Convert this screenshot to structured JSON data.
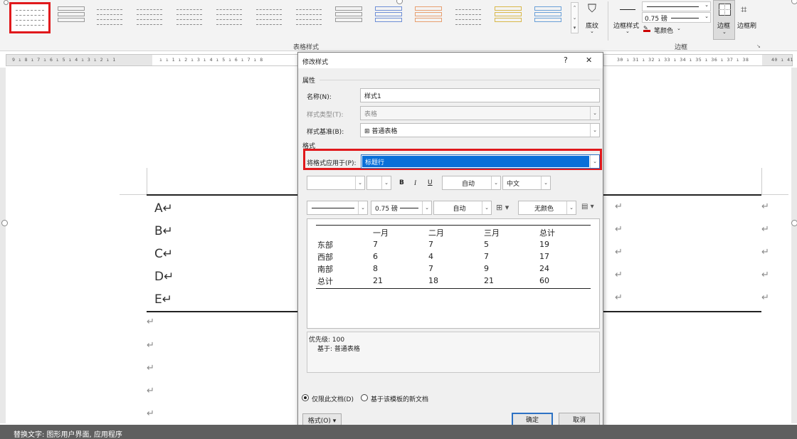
{
  "ribbon": {
    "group_table_styles": "表格样式",
    "group_borders": "边框",
    "shading_label": "底纹",
    "border_styles_label": "边框样式",
    "border_weight": "0.75 磅",
    "pen_color_label": "笔颜色",
    "borders_label": "边框",
    "border_painter_label": "边框刷"
  },
  "ruler": {
    "left_ticks": "9 ı 8 ı 7 ı 6 ı 5 ı 4 ı 3 ı 2 ı 1",
    "mid_ticks": "ı ı 1 ı 2 ı 3 ı 4 ı 5 ı 6 ı 7 ı 8",
    "right_ticks": "30 ı 31 ı 32 ı 33 ı 34 ı 35 ı 36 ı 37 ı 38",
    "end_ticks": "40 ı 41"
  },
  "document": {
    "rows": [
      "A↵",
      "B↵",
      "C↵",
      "D↵",
      "E↵"
    ],
    "ret": "↵"
  },
  "dialog": {
    "title": "修改样式",
    "help": "?",
    "close": "✕",
    "section_properties": "属性",
    "name_label": "名称(N):",
    "name_value": "样式1",
    "style_type_label": "样式类型(T):",
    "style_type_value": "表格",
    "style_based_label": "样式基准(B):",
    "style_based_value": "⊞ 普通表格",
    "section_format": "格式",
    "apply_to_label": "将格式应用于(P):",
    "apply_to_value": "标题行",
    "bold": "B",
    "italic": "I",
    "underline": "U",
    "font_color": "自动",
    "lang": "中文",
    "border_weight": "0.75 磅",
    "border_color": "自动",
    "shading": "无颜色",
    "preview": {
      "headers": [
        "",
        "一月",
        "二月",
        "三月",
        "总计"
      ],
      "rows": [
        [
          "东部",
          "7",
          "7",
          "5",
          "19"
        ],
        [
          "西部",
          "6",
          "4",
          "7",
          "17"
        ],
        [
          "南部",
          "8",
          "7",
          "9",
          "24"
        ],
        [
          "总计",
          "21",
          "18",
          "21",
          "60"
        ]
      ]
    },
    "desc_line1": "优先级: 100",
    "desc_line2": "基于: 普通表格",
    "radio_doc_only": "仅限此文档(D)",
    "radio_template": "基于该模板的新文档",
    "format_button": "格式(O) ▾",
    "ok_button": "确定",
    "cancel_button": "取消"
  },
  "status": {
    "alt_text": "替换文字: 图形用户界面, 应用程序"
  }
}
